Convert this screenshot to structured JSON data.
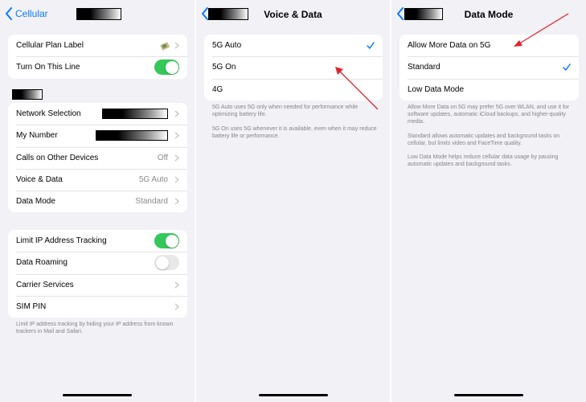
{
  "panel1": {
    "back_label": "Cellular",
    "group1": [
      {
        "label": "Cellular Plan Label",
        "icon": "sim-plan-icon"
      },
      {
        "label": "Turn On This Line",
        "toggle": true
      }
    ],
    "group2": [
      {
        "label": "Network Selection",
        "redacted": true
      },
      {
        "label": "My Number",
        "redacted": true
      },
      {
        "label": "Calls on Other Devices",
        "value": "Off"
      },
      {
        "label": "Voice & Data",
        "value": "5G Auto"
      },
      {
        "label": "Data Mode",
        "value": "Standard"
      }
    ],
    "group3": [
      {
        "label": "Limit IP Address Tracking",
        "toggle": true
      },
      {
        "label": "Data Roaming",
        "toggle": false
      },
      {
        "label": "Carrier Services"
      },
      {
        "label": "SIM PIN"
      }
    ],
    "footnote": "Limit IP address tracking by hiding your IP address from known trackers in Mail and Safari."
  },
  "panel2": {
    "title": "Voice & Data",
    "options": [
      {
        "label": "5G Auto",
        "selected": true
      },
      {
        "label": "5G On",
        "selected": false
      },
      {
        "label": "4G",
        "selected": false
      }
    ],
    "footnote1": "5G Auto uses 5G only when needed for performance while optimizing battery life.",
    "footnote2": "5G On uses 5G whenever it is available, even when it may reduce battery life or performance."
  },
  "panel3": {
    "title": "Data Mode",
    "options": [
      {
        "label": "Allow More Data on 5G",
        "selected": false
      },
      {
        "label": "Standard",
        "selected": true
      },
      {
        "label": "Low Data Mode",
        "selected": false
      }
    ],
    "footnote1": "Allow More Data on 5G may prefer 5G over WLAN, and use it for software updates, automatic iCloud backups, and higher-quality media.",
    "footnote2": "Standard allows automatic updates and background tasks on cellular, but limits video and FaceTime quality.",
    "footnote3": "Low Data Mode helps reduce cellular data usage by pausing automatic updates and background tasks."
  },
  "colors": {
    "accent": "#0a7aff",
    "toggle_on": "#34c759",
    "background": "#f2f1f6",
    "annotation_arrow": "#e0242f"
  }
}
